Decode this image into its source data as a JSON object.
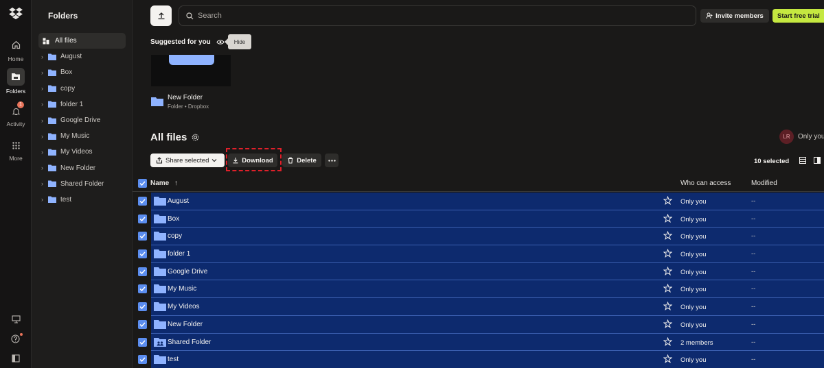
{
  "rail": {
    "items": [
      {
        "label": "Home",
        "icon": "home-icon"
      },
      {
        "label": "Folders",
        "icon": "folder-icon"
      },
      {
        "label": "Activity",
        "icon": "bell-icon",
        "badge": "1"
      },
      {
        "label": "More",
        "icon": "grid-icon"
      }
    ]
  },
  "sidebar": {
    "title": "Folders",
    "items": [
      {
        "label": "All files"
      },
      {
        "label": "August"
      },
      {
        "label": "Box"
      },
      {
        "label": "copy"
      },
      {
        "label": "folder 1"
      },
      {
        "label": "Google Drive"
      },
      {
        "label": "My Music"
      },
      {
        "label": "My Videos"
      },
      {
        "label": "New Folder"
      },
      {
        "label": "Shared Folder"
      },
      {
        "label": "test"
      }
    ]
  },
  "header": {
    "search_placeholder": "Search",
    "invite_label": "Invite members",
    "trial_label": "Start free trial"
  },
  "suggested": {
    "title": "Suggested for you",
    "hide_tooltip": "Hide",
    "item_name": "New Folder",
    "item_sub": "Folder • Dropbox"
  },
  "files": {
    "title": "All files",
    "avatar_initials": "LR",
    "access_label": "Only you",
    "share_label": "Share selected",
    "download_label": "Download",
    "delete_label": "Delete",
    "selected_count": "10 selected",
    "columns": {
      "name": "Name",
      "access": "Who can access",
      "modified": "Modified"
    },
    "rows": [
      {
        "name": "August",
        "access": "Only you",
        "modified": "--"
      },
      {
        "name": "Box",
        "access": "Only you",
        "modified": "--"
      },
      {
        "name": "copy",
        "access": "Only you",
        "modified": "--"
      },
      {
        "name": "folder 1",
        "access": "Only you",
        "modified": "--"
      },
      {
        "name": "Google Drive",
        "access": "Only you",
        "modified": "--"
      },
      {
        "name": "My Music",
        "access": "Only you",
        "modified": "--"
      },
      {
        "name": "My Videos",
        "access": "Only you",
        "modified": "--"
      },
      {
        "name": "New Folder",
        "access": "Only you",
        "modified": "--"
      },
      {
        "name": "Shared Folder",
        "access": "2 members",
        "modified": "--"
      },
      {
        "name": "test",
        "access": "Only you",
        "modified": "--"
      }
    ]
  },
  "colors": {
    "accent": "#5b8def",
    "selection": "#0d2a6e",
    "trial": "#c5e840",
    "folder": "#8fb3ff",
    "highlight": "#e0202a"
  }
}
